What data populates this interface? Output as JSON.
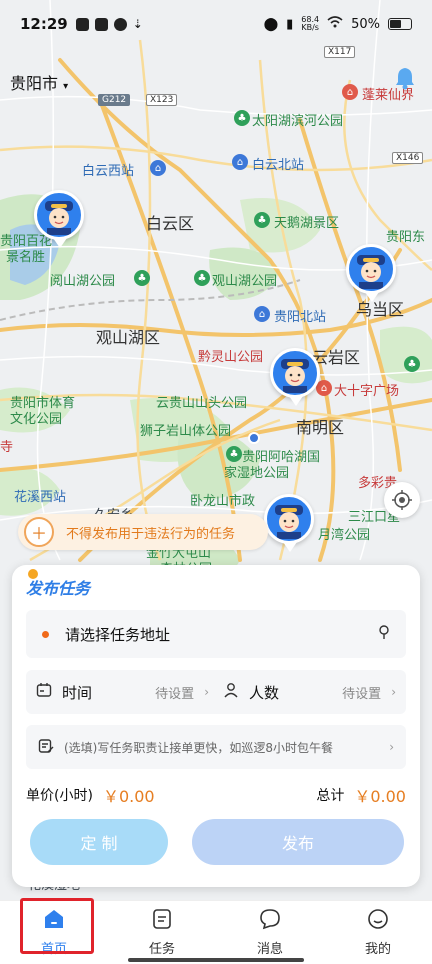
{
  "status_bar": {
    "time": "12:29",
    "network_speed_top": "68.4",
    "network_speed_unit": "KB/s",
    "battery": "50%"
  },
  "map": {
    "city": "贵阳市",
    "labels": {
      "lake_park_top": "太阳湖滨河公园",
      "penglai": "蓬莱仙界",
      "baiyun_west": "白云西站",
      "baiyun_north": "白云北站",
      "baiyun_district": "白云区",
      "tiane_lake": "天鹅湖景区",
      "guiyang_east": "贵阳东",
      "guiyang_baihua": "贵阳百花",
      "jingshen": "景名胜",
      "aha": "阅山湖公园",
      "guanshanhu_park": "观山湖公园",
      "wudang": "乌当区",
      "guanshanhu": "观山湖区",
      "guiyang_north": "贵阳北站",
      "qianling": "黔灵山公园",
      "yunyan": "云岩区",
      "sports_center": "贵阳市体育",
      "culture_park": "文化公园",
      "dashizi": "大十字广场",
      "yunding": "云贵山山头公园",
      "nanming": "南明区",
      "shizi": "狮子岩山体公园",
      "aha_wetland": "贵阳阿哈湖国",
      "wetland_park": "家湿地公园",
      "temple": "寺",
      "huaxi_west": "花溪西站",
      "duocai": "多彩贵",
      "wolong": "卧龙山市政",
      "sanjiang": "三江口星",
      "bay_park": "月湾公园",
      "jinyang": "金竹大屯山",
      "forest": "森林公园",
      "jiuan": "久安乡",
      "bottom": "花溪湿地"
    },
    "road_shields": [
      "X117",
      "G212",
      "X123",
      "X146"
    ]
  },
  "warning_banner": {
    "text": "不得发布用于违法行为的任务"
  },
  "task_card": {
    "title": "发布任务",
    "address_placeholder": "请选择任务地址",
    "time_label": "时间",
    "time_value": "待设置",
    "people_label": "人数",
    "people_value": "待设置",
    "note_placeholder": "(选填)写任务职责让接单更快，如巡逻8小时包午餐",
    "unit_price_label": "单价(小时)",
    "unit_price_value": "￥0.00",
    "total_label": "总计",
    "total_value": "￥0.00",
    "custom_button": "定 制",
    "publish_button": "发布"
  },
  "bottom_nav": {
    "items": [
      {
        "label": "首页",
        "icon": "home-icon",
        "active": true
      },
      {
        "label": "任务",
        "icon": "task-icon",
        "active": false
      },
      {
        "label": "消息",
        "icon": "message-icon",
        "active": false
      },
      {
        "label": "我的",
        "icon": "profile-icon",
        "active": false
      }
    ]
  },
  "colors": {
    "accent": "#2f80ed",
    "warning": "#e27a1c",
    "price": "#e67e22",
    "highlight": "#e0232b"
  }
}
